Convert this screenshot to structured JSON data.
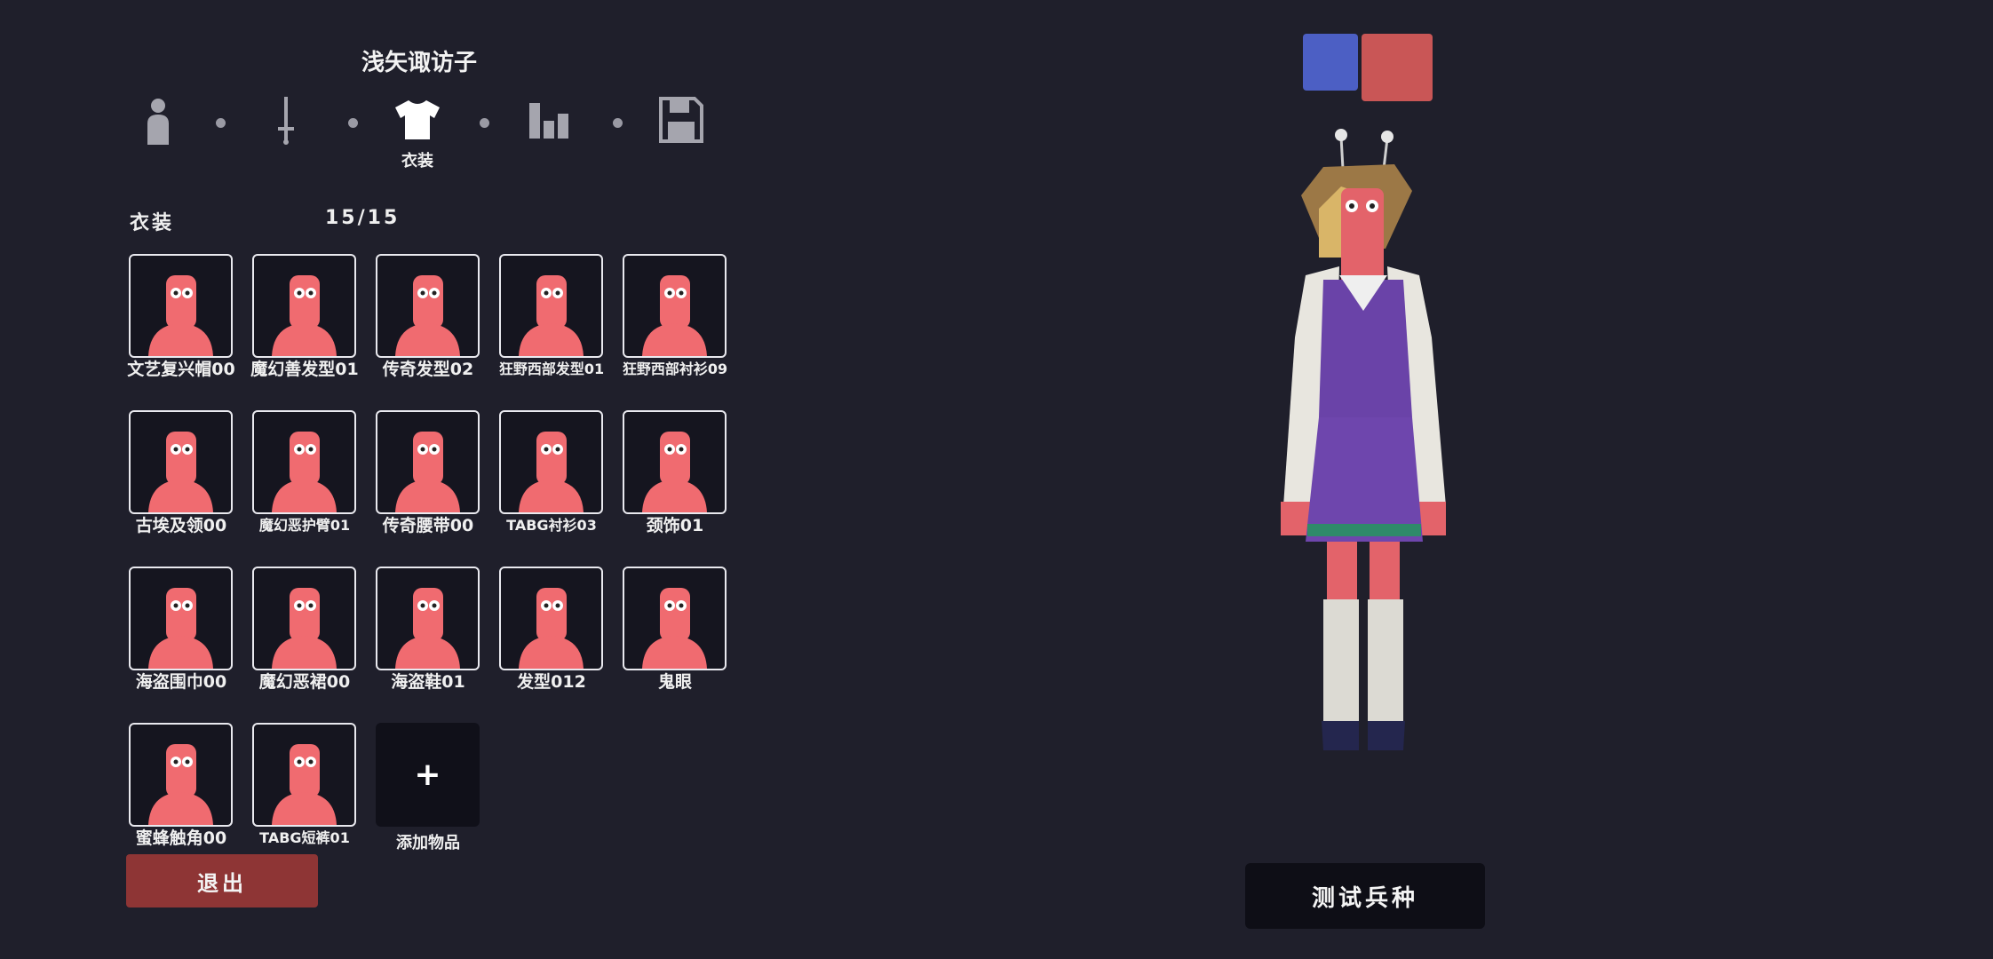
{
  "unit": {
    "name": "浅矢诹访子"
  },
  "steps": [
    {
      "icon": "unit-icon",
      "label": ""
    },
    {
      "icon": "sword-icon",
      "label": ""
    },
    {
      "icon": "shirt-icon",
      "label": "衣装",
      "active": true
    },
    {
      "icon": "stats-icon",
      "label": ""
    },
    {
      "icon": "save-icon",
      "label": ""
    }
  ],
  "section": {
    "title": "衣装",
    "count": "15/15"
  },
  "items": [
    {
      "label": "文艺复兴帽00"
    },
    {
      "label": "魔幻善发型01"
    },
    {
      "label": "传奇发型02"
    },
    {
      "label": "狂野西部发型01"
    },
    {
      "label": "狂野西部衬衫09"
    },
    {
      "label": "古埃及领00"
    },
    {
      "label": "魔幻恶护臂01"
    },
    {
      "label": "传奇腰带00"
    },
    {
      "label": "TABG衬衫03"
    },
    {
      "label": "颈饰01"
    },
    {
      "label": "海盗围巾00"
    },
    {
      "label": "魔幻恶裙00"
    },
    {
      "label": "海盗鞋01"
    },
    {
      "label": "发型012"
    },
    {
      "label": "鬼眼"
    },
    {
      "label": "蜜蜂触角00"
    },
    {
      "label": "TABG短裤01"
    }
  ],
  "add_item": {
    "symbol": "+",
    "label": "添加物品"
  },
  "buttons": {
    "exit": "退出",
    "test": "测试兵种"
  },
  "colors": {
    "team_blue": "#4c5fc4",
    "team_red": "#c95656",
    "exit": "#8e3535"
  }
}
